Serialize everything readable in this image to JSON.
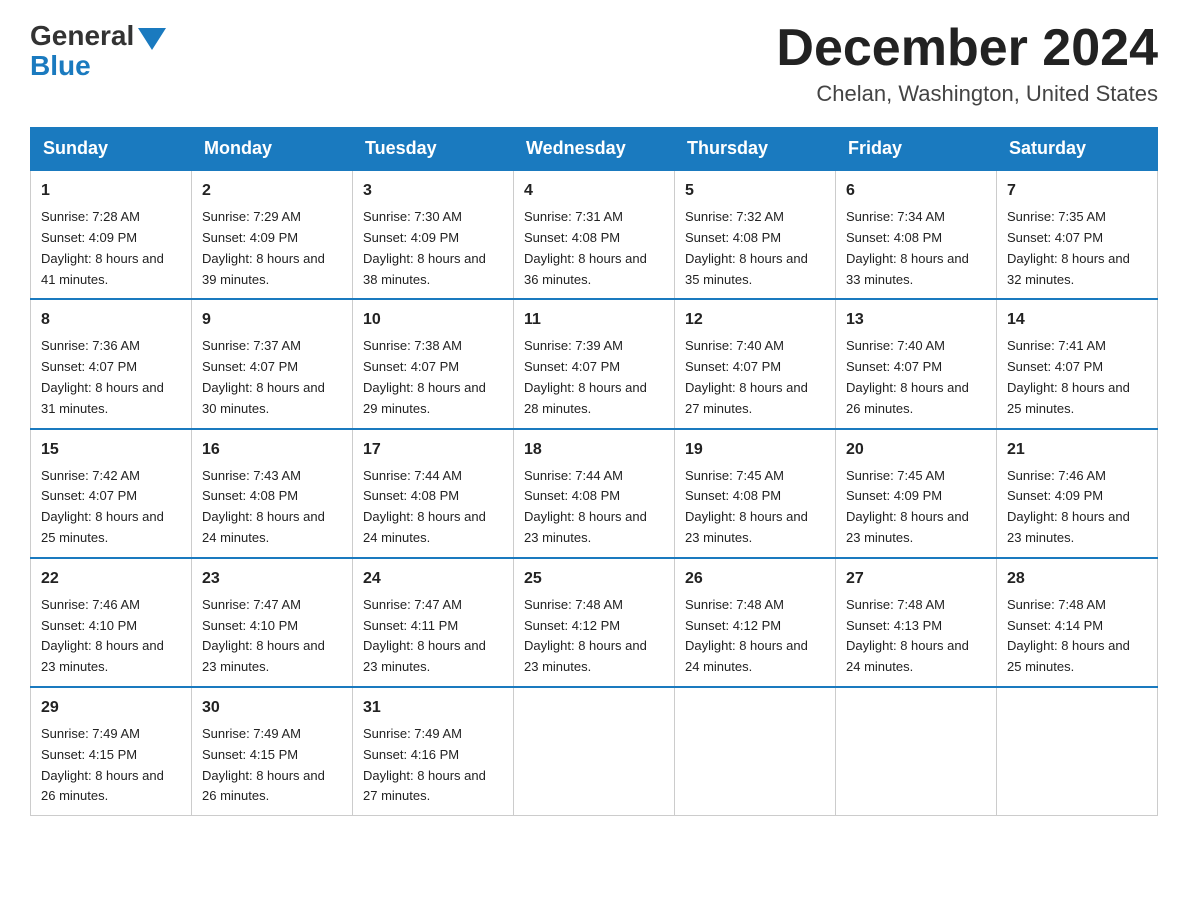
{
  "header": {
    "logo_general": "General",
    "logo_blue": "Blue",
    "month_title": "December 2024",
    "location": "Chelan, Washington, United States"
  },
  "days_of_week": [
    "Sunday",
    "Monday",
    "Tuesday",
    "Wednesday",
    "Thursday",
    "Friday",
    "Saturday"
  ],
  "weeks": [
    [
      {
        "day": "1",
        "sunrise": "7:28 AM",
        "sunset": "4:09 PM",
        "daylight": "8 hours and 41 minutes."
      },
      {
        "day": "2",
        "sunrise": "7:29 AM",
        "sunset": "4:09 PM",
        "daylight": "8 hours and 39 minutes."
      },
      {
        "day": "3",
        "sunrise": "7:30 AM",
        "sunset": "4:09 PM",
        "daylight": "8 hours and 38 minutes."
      },
      {
        "day": "4",
        "sunrise": "7:31 AM",
        "sunset": "4:08 PM",
        "daylight": "8 hours and 36 minutes."
      },
      {
        "day": "5",
        "sunrise": "7:32 AM",
        "sunset": "4:08 PM",
        "daylight": "8 hours and 35 minutes."
      },
      {
        "day": "6",
        "sunrise": "7:34 AM",
        "sunset": "4:08 PM",
        "daylight": "8 hours and 33 minutes."
      },
      {
        "day": "7",
        "sunrise": "7:35 AM",
        "sunset": "4:07 PM",
        "daylight": "8 hours and 32 minutes."
      }
    ],
    [
      {
        "day": "8",
        "sunrise": "7:36 AM",
        "sunset": "4:07 PM",
        "daylight": "8 hours and 31 minutes."
      },
      {
        "day": "9",
        "sunrise": "7:37 AM",
        "sunset": "4:07 PM",
        "daylight": "8 hours and 30 minutes."
      },
      {
        "day": "10",
        "sunrise": "7:38 AM",
        "sunset": "4:07 PM",
        "daylight": "8 hours and 29 minutes."
      },
      {
        "day": "11",
        "sunrise": "7:39 AM",
        "sunset": "4:07 PM",
        "daylight": "8 hours and 28 minutes."
      },
      {
        "day": "12",
        "sunrise": "7:40 AM",
        "sunset": "4:07 PM",
        "daylight": "8 hours and 27 minutes."
      },
      {
        "day": "13",
        "sunrise": "7:40 AM",
        "sunset": "4:07 PM",
        "daylight": "8 hours and 26 minutes."
      },
      {
        "day": "14",
        "sunrise": "7:41 AM",
        "sunset": "4:07 PM",
        "daylight": "8 hours and 25 minutes."
      }
    ],
    [
      {
        "day": "15",
        "sunrise": "7:42 AM",
        "sunset": "4:07 PM",
        "daylight": "8 hours and 25 minutes."
      },
      {
        "day": "16",
        "sunrise": "7:43 AM",
        "sunset": "4:08 PM",
        "daylight": "8 hours and 24 minutes."
      },
      {
        "day": "17",
        "sunrise": "7:44 AM",
        "sunset": "4:08 PM",
        "daylight": "8 hours and 24 minutes."
      },
      {
        "day": "18",
        "sunrise": "7:44 AM",
        "sunset": "4:08 PM",
        "daylight": "8 hours and 23 minutes."
      },
      {
        "day": "19",
        "sunrise": "7:45 AM",
        "sunset": "4:08 PM",
        "daylight": "8 hours and 23 minutes."
      },
      {
        "day": "20",
        "sunrise": "7:45 AM",
        "sunset": "4:09 PM",
        "daylight": "8 hours and 23 minutes."
      },
      {
        "day": "21",
        "sunrise": "7:46 AM",
        "sunset": "4:09 PM",
        "daylight": "8 hours and 23 minutes."
      }
    ],
    [
      {
        "day": "22",
        "sunrise": "7:46 AM",
        "sunset": "4:10 PM",
        "daylight": "8 hours and 23 minutes."
      },
      {
        "day": "23",
        "sunrise": "7:47 AM",
        "sunset": "4:10 PM",
        "daylight": "8 hours and 23 minutes."
      },
      {
        "day": "24",
        "sunrise": "7:47 AM",
        "sunset": "4:11 PM",
        "daylight": "8 hours and 23 minutes."
      },
      {
        "day": "25",
        "sunrise": "7:48 AM",
        "sunset": "4:12 PM",
        "daylight": "8 hours and 23 minutes."
      },
      {
        "day": "26",
        "sunrise": "7:48 AM",
        "sunset": "4:12 PM",
        "daylight": "8 hours and 24 minutes."
      },
      {
        "day": "27",
        "sunrise": "7:48 AM",
        "sunset": "4:13 PM",
        "daylight": "8 hours and 24 minutes."
      },
      {
        "day": "28",
        "sunrise": "7:48 AM",
        "sunset": "4:14 PM",
        "daylight": "8 hours and 25 minutes."
      }
    ],
    [
      {
        "day": "29",
        "sunrise": "7:49 AM",
        "sunset": "4:15 PM",
        "daylight": "8 hours and 26 minutes."
      },
      {
        "day": "30",
        "sunrise": "7:49 AM",
        "sunset": "4:15 PM",
        "daylight": "8 hours and 26 minutes."
      },
      {
        "day": "31",
        "sunrise": "7:49 AM",
        "sunset": "4:16 PM",
        "daylight": "8 hours and 27 minutes."
      },
      null,
      null,
      null,
      null
    ]
  ]
}
